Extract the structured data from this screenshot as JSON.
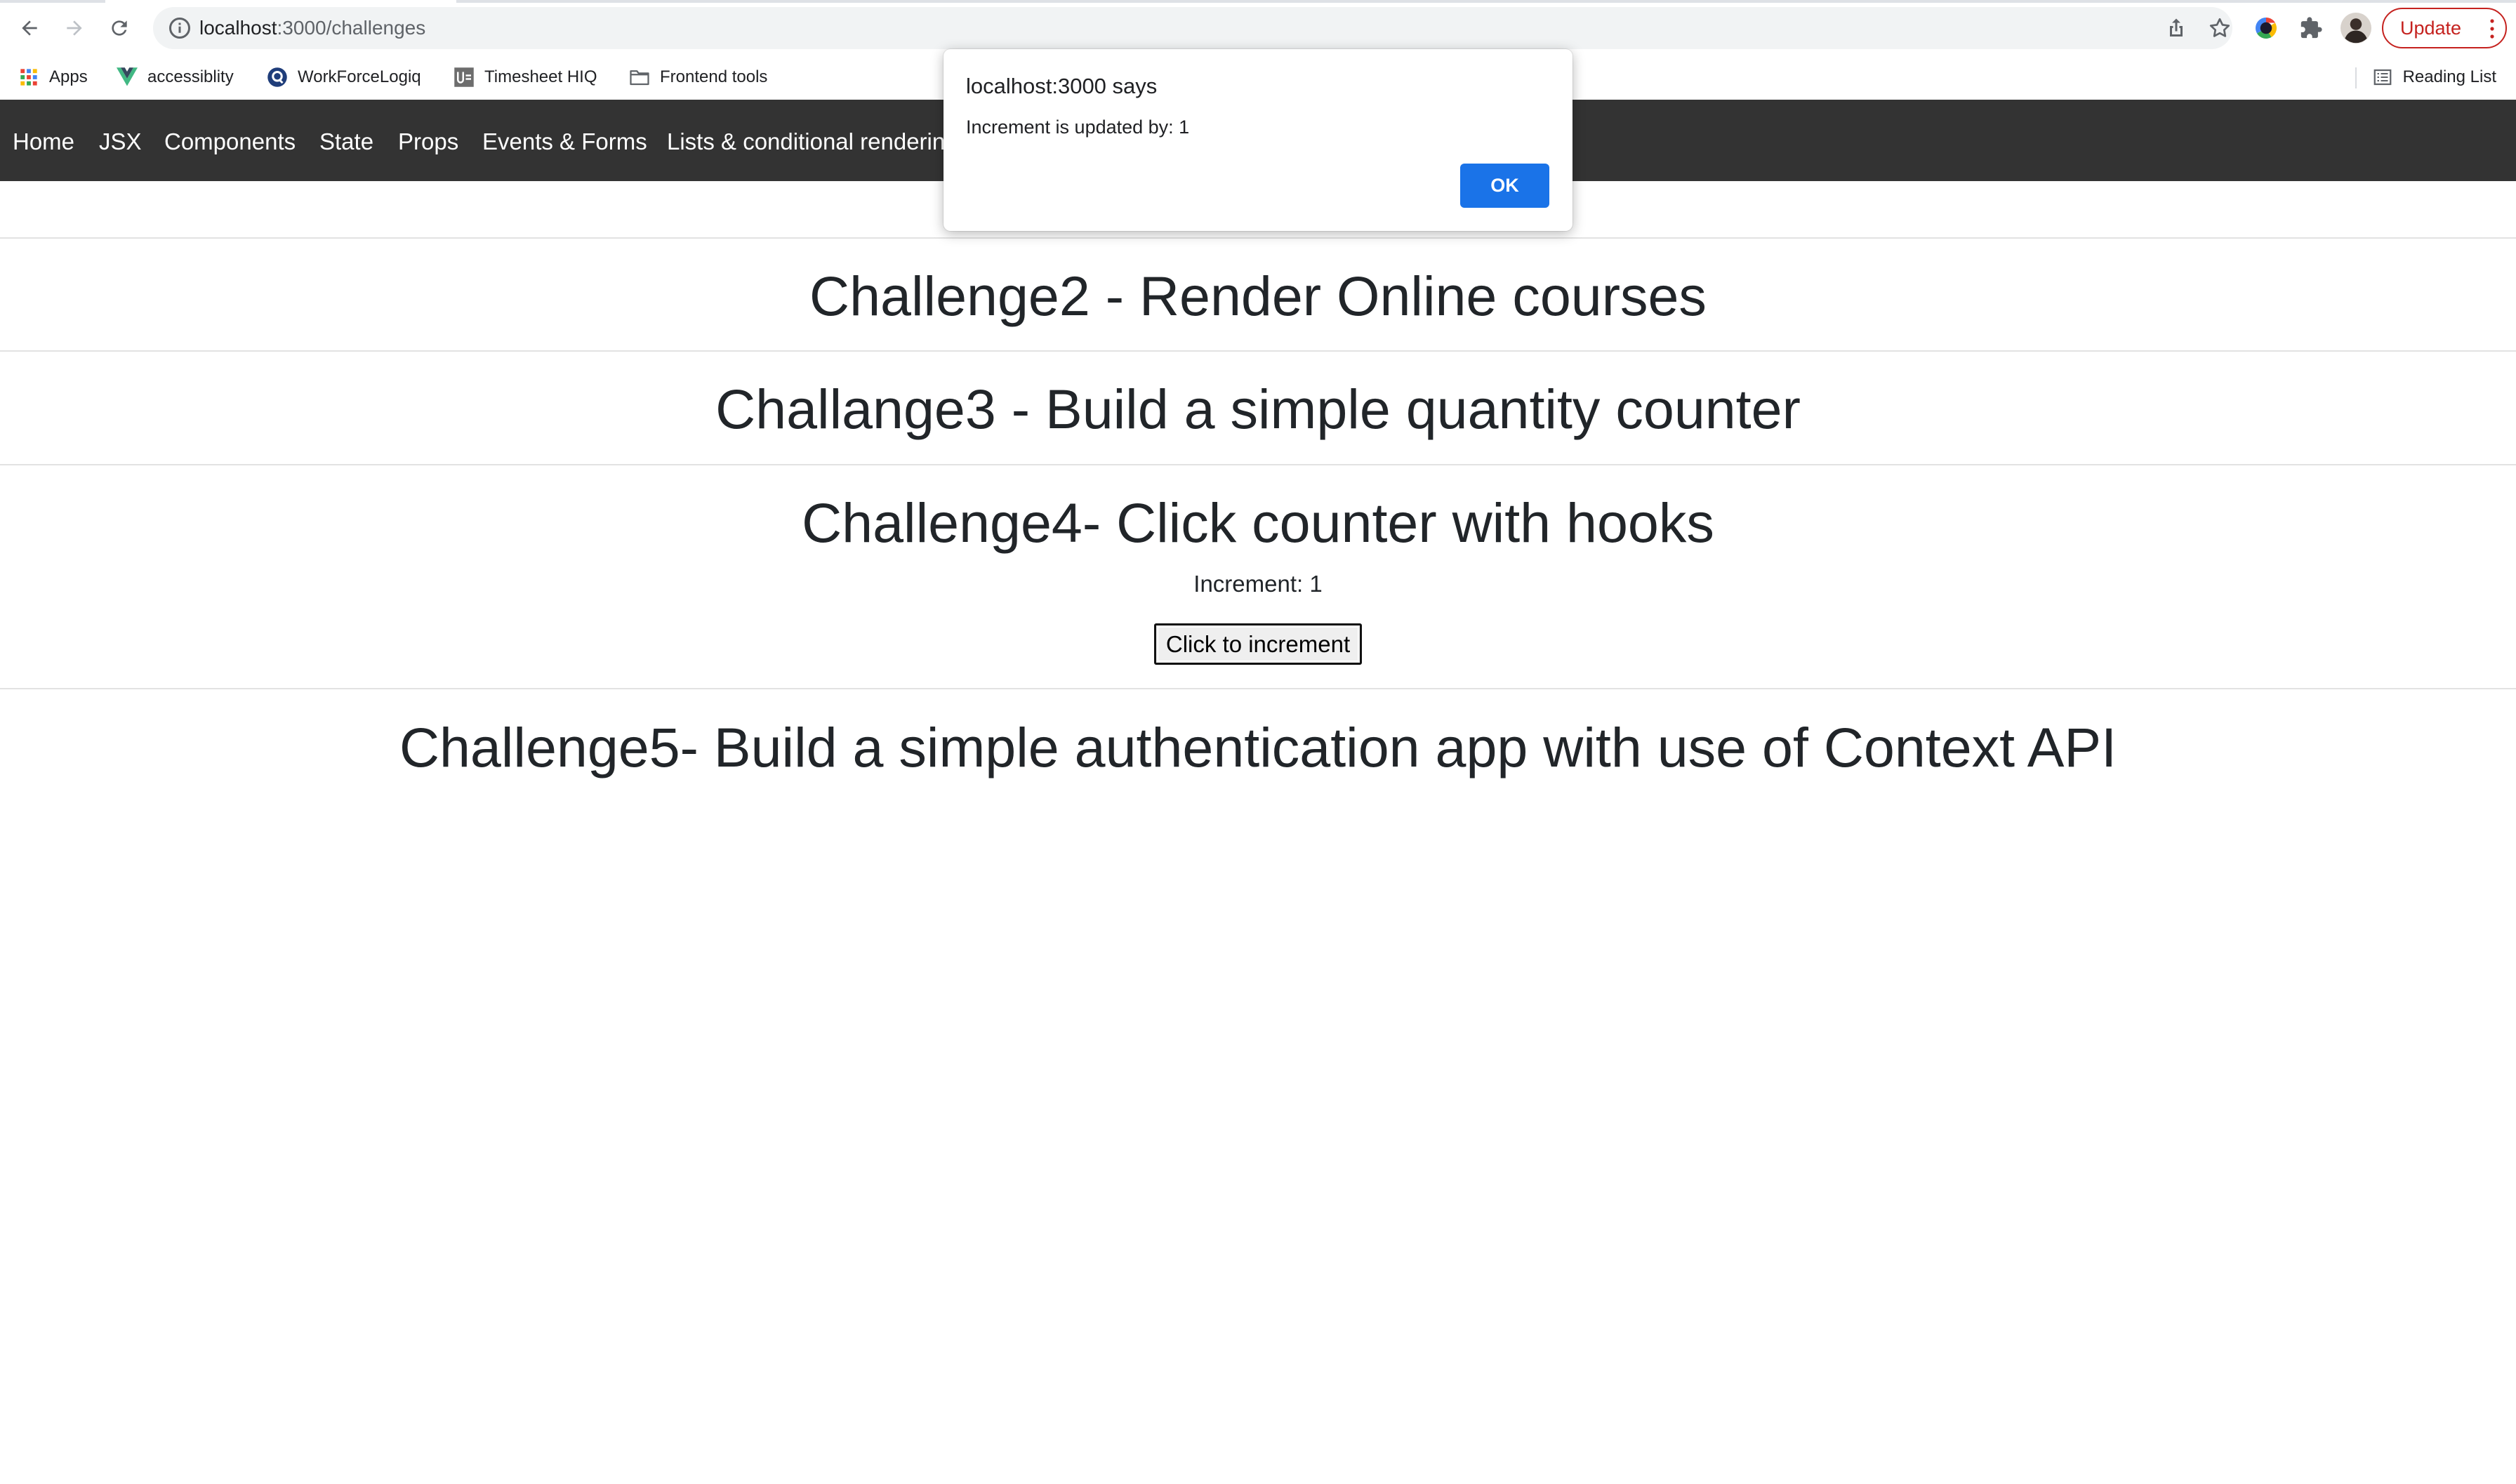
{
  "browser": {
    "url_host": "localhost",
    "url_path": ":3000/challenges",
    "update_label": "Update",
    "bookmarks": [
      {
        "label": "Apps",
        "icon": "apps-grid-icon"
      },
      {
        "label": "accessiblity",
        "icon": "vue-logo-icon"
      },
      {
        "label": "WorkForceLogiq",
        "icon": "workforcelogiq-icon"
      },
      {
        "label": "Timesheet HIQ",
        "icon": "timesheet-icon"
      },
      {
        "label": "Frontend tools",
        "icon": "folder-icon"
      }
    ],
    "reading_list_label": "Reading List"
  },
  "navbar": {
    "links": [
      "Home",
      "JSX",
      "Components",
      "State",
      "Props",
      "Events & Forms",
      "Lists & conditional renderin"
    ]
  },
  "sections": {
    "challenge2_title": "Challenge2 - Render Online courses",
    "challenge3_title": "Challange3 - Build a simple quantity counter",
    "challenge4_title": "Challenge4- Click counter with hooks",
    "challenge4_counter": "Increment: 1",
    "challenge4_button": "Click to increment",
    "challenge5_title": "Challenge5- Build a simple authentication app with use of Context API"
  },
  "dialog": {
    "title": "localhost:3000 says",
    "message": "Increment is updated by: 1",
    "ok_label": "OK"
  },
  "colors": {
    "navbar_bg": "#333333",
    "dialog_ok": "#1a73e8",
    "update_red": "#c5221f"
  }
}
